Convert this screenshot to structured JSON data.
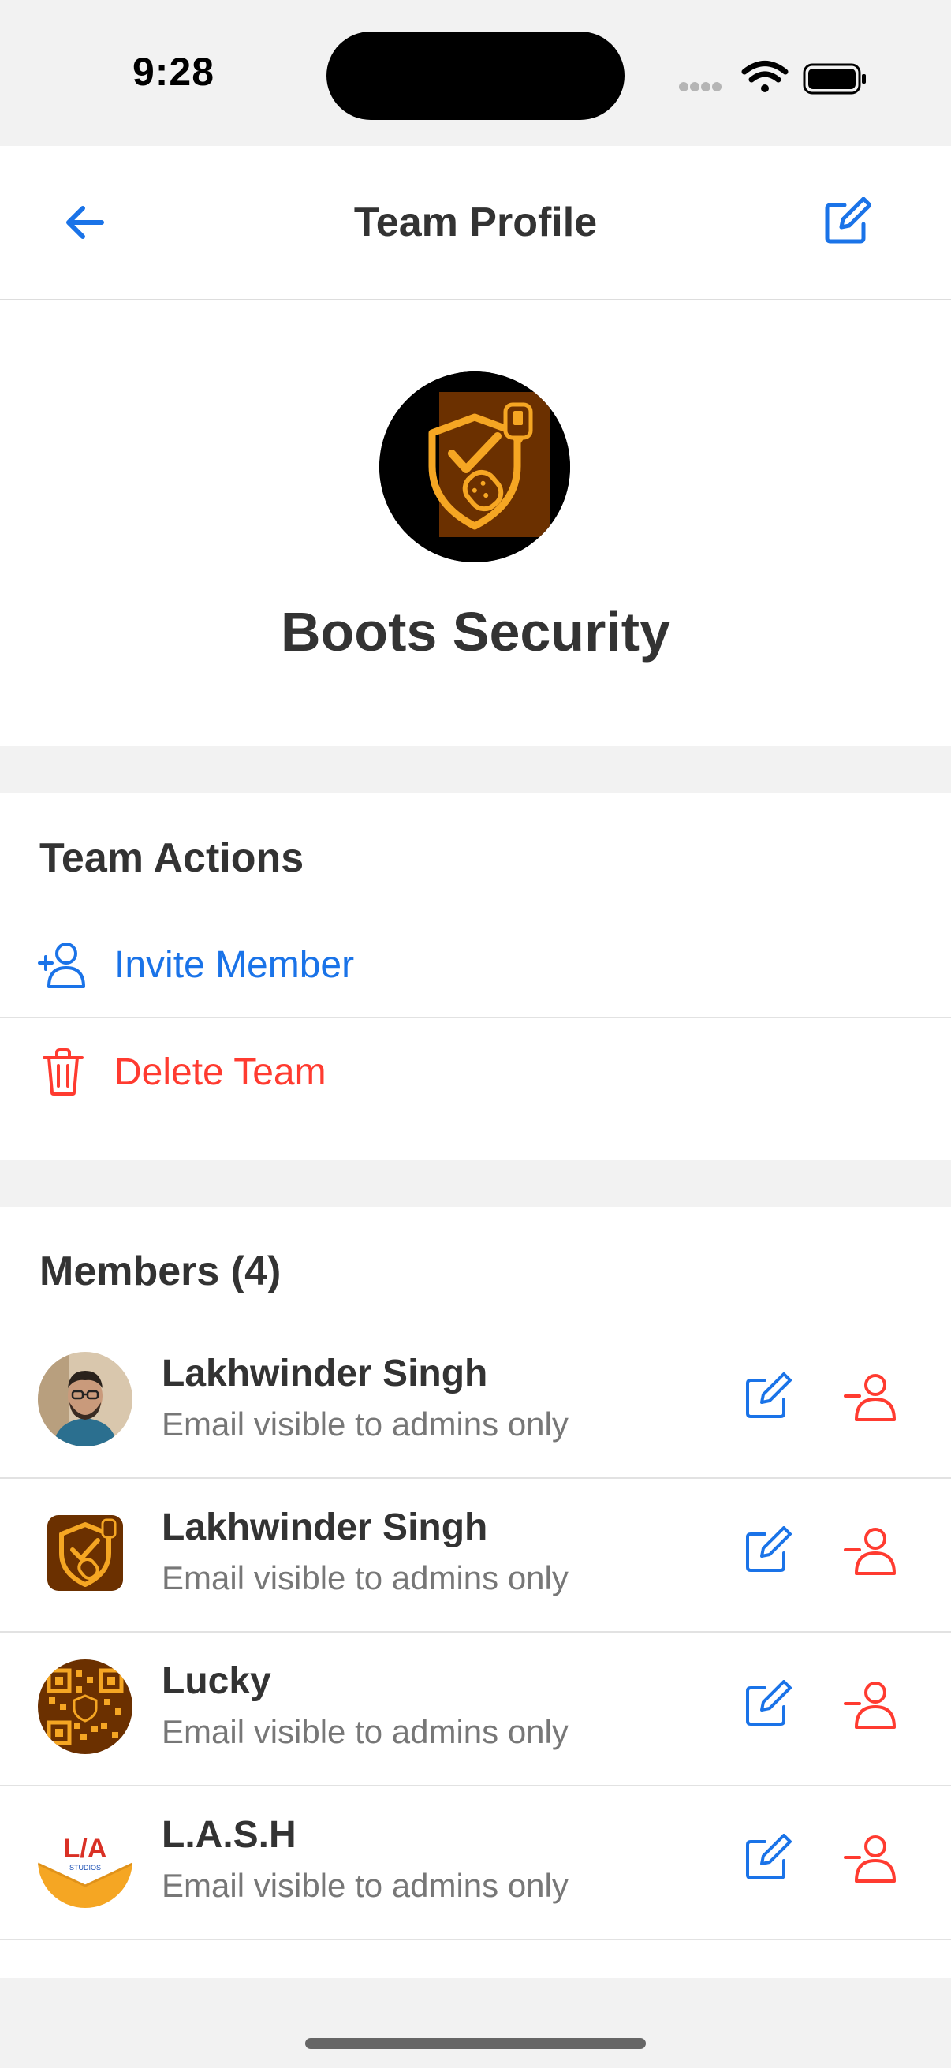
{
  "status_bar": {
    "time": "9:28",
    "icons": [
      "cellular-signal-icon",
      "wifi-icon",
      "battery-icon"
    ]
  },
  "nav": {
    "title": "Team Profile",
    "back_icon": "arrow-left-icon",
    "edit_icon": "edit-square-icon"
  },
  "team": {
    "name": "Boots Security",
    "logo_icon": "shield-check-boot-icon"
  },
  "actions": {
    "title": "Team Actions",
    "items": [
      {
        "label": "Invite Member",
        "icon": "person-add-icon",
        "color": "#1a73e8"
      },
      {
        "label": "Delete Team",
        "icon": "trash-icon",
        "color": "#ff3b30"
      }
    ]
  },
  "members": {
    "title": "Members (4)",
    "items": [
      {
        "name": "Lakhwinder Singh",
        "subtitle": "Email visible to admins only",
        "avatar": "photo-avatar"
      },
      {
        "name": "Lakhwinder Singh",
        "subtitle": "Email visible to admins only",
        "avatar": "shield-logo-avatar"
      },
      {
        "name": "Lucky",
        "subtitle": "Email visible to admins only",
        "avatar": "qr-pattern-avatar"
      },
      {
        "name": "L.A.S.H",
        "subtitle": "Email visible to admins only",
        "avatar": "lash-logo-avatar",
        "logo_text": "L/A",
        "logo_subtext": "STUDIOS"
      }
    ]
  },
  "colors": {
    "accent": "#1a73e8",
    "danger": "#ff3b30",
    "text": "#333333",
    "secondary_text": "#777777",
    "background": "#f2f2f2",
    "card": "#ffffff",
    "logo_brown": "#6b3000",
    "logo_gold": "#f5a623"
  }
}
